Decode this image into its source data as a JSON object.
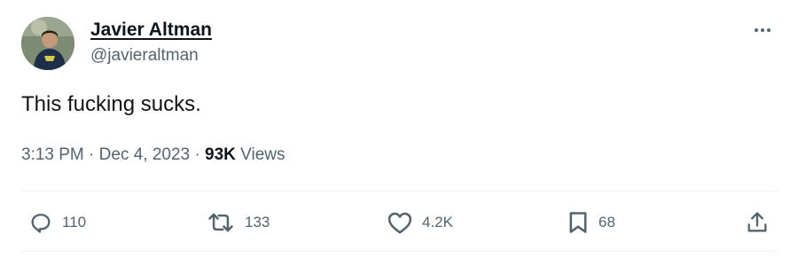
{
  "author": {
    "display_name": "Javier Altman",
    "handle": "@javieraltman"
  },
  "tweet": {
    "text": "This fucking sucks."
  },
  "meta": {
    "time": "3:13 PM",
    "separator": "·",
    "date": "Dec 4, 2023",
    "views_count": "93K",
    "views_label": "Views"
  },
  "actions": {
    "replies": "110",
    "reposts": "133",
    "likes": "4.2K",
    "bookmarks": "68"
  },
  "icons": {
    "more": "more-icon",
    "reply": "reply-icon",
    "repost": "repost-icon",
    "like": "heart-icon",
    "bookmark": "bookmark-icon",
    "share": "share-icon"
  },
  "colors": {
    "text_primary": "#0f1419",
    "text_secondary": "#536471",
    "divider": "#eff3f4"
  }
}
